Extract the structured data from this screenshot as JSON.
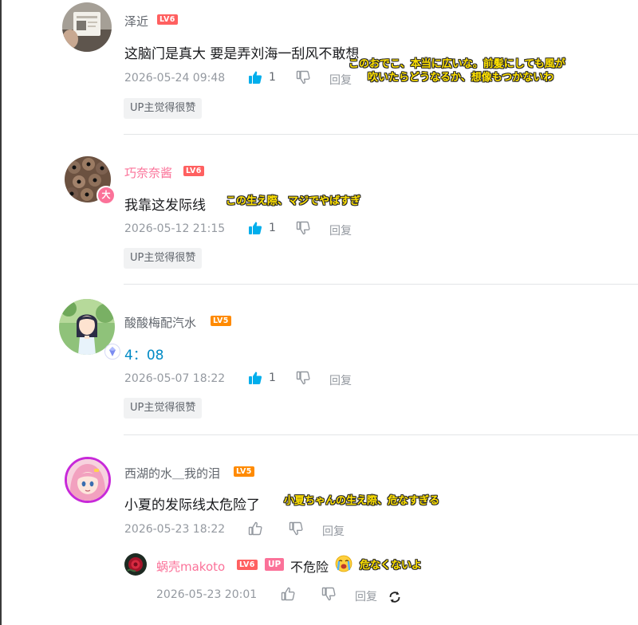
{
  "comments": [
    {
      "username": "泽近",
      "level": "LV6",
      "text": "这脑门是真大 要是弄刘海一刮风不敢想",
      "subtitle_line1": "このおでこ、本当に広いな。前髪にしても風が",
      "subtitle_line2": "吹いたらどうなるか、想像もつかないわ",
      "time": "2026-05-24 09:48",
      "likes": "1",
      "reply_label": "回复",
      "badge": "UP主觉得很赞"
    },
    {
      "username": "巧奈奈酱",
      "level": "LV6",
      "text": "我靠这发际线",
      "subtitle": "この生え際、マジでやばすぎ",
      "avatar_badge": "大",
      "time": "2026-05-12 21:15",
      "likes": "1",
      "reply_label": "回复",
      "badge": "UP主觉得很赞"
    },
    {
      "username": "酸酸梅配汽水",
      "level": "LV5",
      "text": "4：08",
      "time": "2026-05-07 18:22",
      "likes": "1",
      "reply_label": "回复",
      "badge": "UP主觉得很赞"
    },
    {
      "username": "西湖的水＿我的泪",
      "level": "LV5",
      "text": "小夏的发际线太危险了",
      "subtitle": "小夏ちゃんの生え際、危なすぎる",
      "time": "2026-05-23 18:22",
      "reply_label": "回复",
      "reply": {
        "username": "蜗壳makoto",
        "level": "LV6",
        "up_tag": "UP",
        "text": "不危险",
        "subtitle": "危なくないよ",
        "time": "2026-05-23 20:01",
        "reply_label": "回复"
      }
    }
  ],
  "colors": {
    "accent_blue": "#00aeec",
    "pink": "#fb7299",
    "lv6": "#ff6060",
    "lv5": "#ff8a00",
    "subtitle_yellow": "#ffe100"
  }
}
